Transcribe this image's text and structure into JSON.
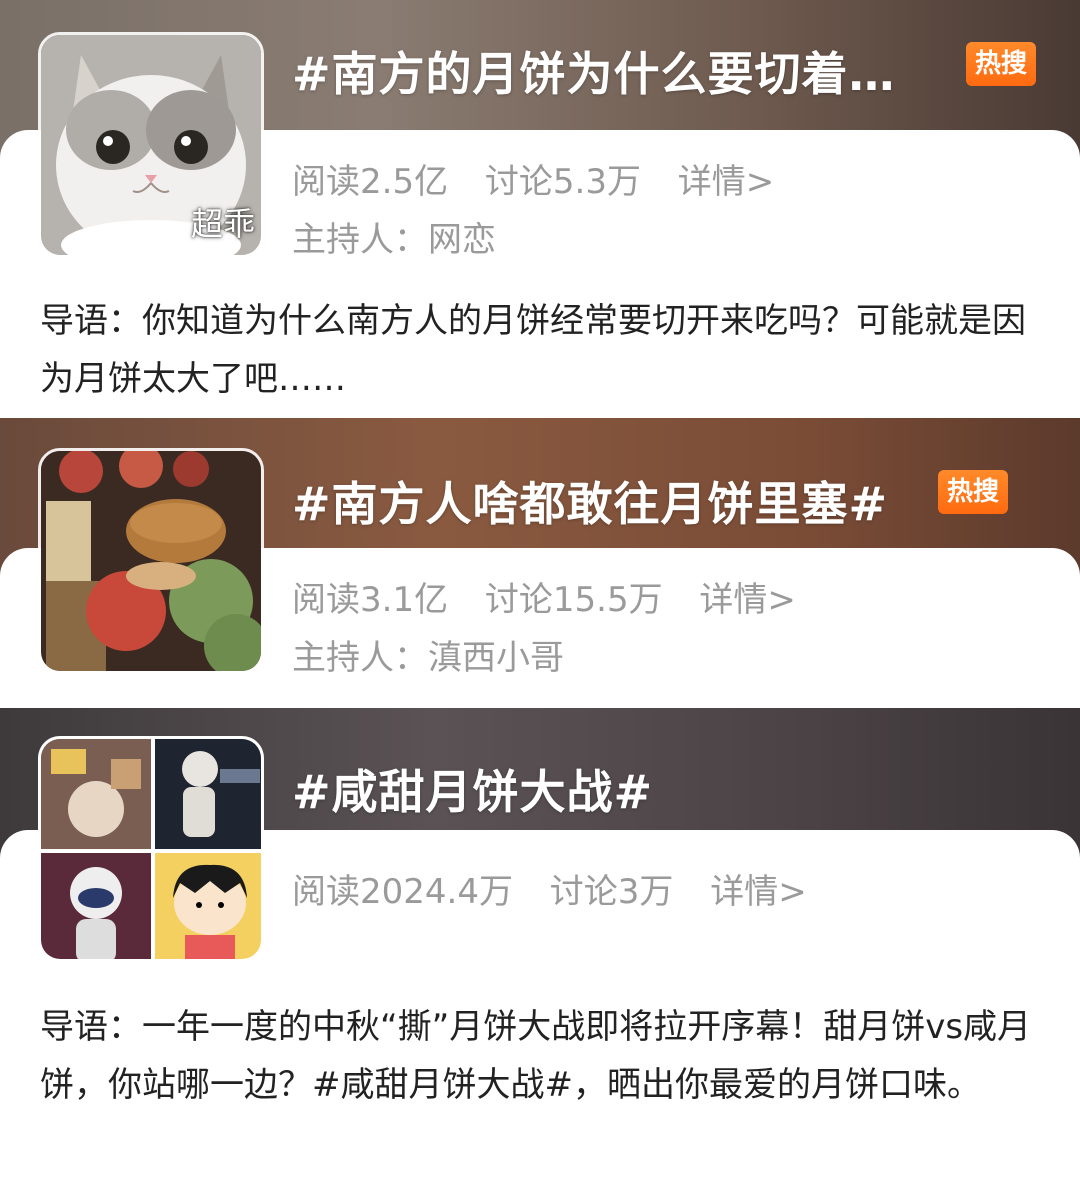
{
  "topics": [
    {
      "title": "#南方的月饼为什么要切着…",
      "hot_badge": "热搜",
      "stats": {
        "read": "阅读2.5亿",
        "discuss": "讨论5.3万",
        "detail": "详情>"
      },
      "host": "主持人：网恋",
      "sticker_text": "超乖",
      "intro": "导语：你知道为什么南方人的月饼经常要切开来吃吗？可能就是因为月饼太大了吧……"
    },
    {
      "title": "#南方人啥都敢往月饼里塞#",
      "hot_badge": "热搜",
      "stats": {
        "read": "阅读3.1亿",
        "discuss": "讨论15.5万",
        "detail": "详情>"
      },
      "host": "主持人：滇西小哥"
    },
    {
      "title": "#咸甜月饼大战#",
      "stats": {
        "read": "阅读2024.4万",
        "discuss": "讨论3万",
        "detail": "详情>"
      },
      "intro": "导语：一年一度的中秋“撕”月饼大战即将拉开序幕！甜月饼vs咸月饼，你站哪一边？#咸甜月饼大战#，晒出你最爱的月饼口味。"
    }
  ],
  "icons": [
    "cat-photo",
    "mooncake-food-photo",
    "collage-photo"
  ],
  "colors": {
    "hot_badge": "#ff7a1c",
    "meta_text": "#9a9a9a",
    "body_text": "#222222"
  }
}
